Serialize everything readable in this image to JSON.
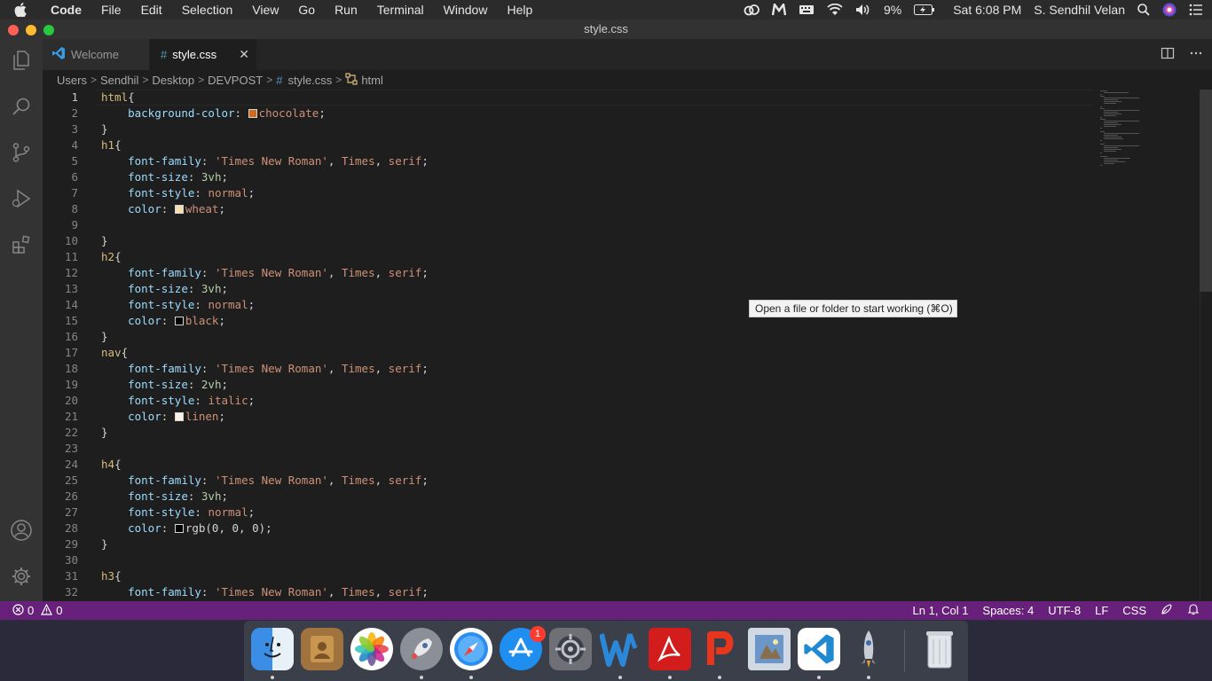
{
  "menubar": {
    "app": "Code",
    "items": [
      "File",
      "Edit",
      "Selection",
      "View",
      "Go",
      "Run",
      "Terminal",
      "Window",
      "Help"
    ],
    "battery": "9%",
    "clock": "Sat 6:08 PM",
    "user": "S. Sendhil Velan"
  },
  "window": {
    "title": "style.css"
  },
  "tabs": [
    {
      "label": "Welcome",
      "icon": "vscode-icon"
    },
    {
      "label": "style.css",
      "icon": "hash-icon",
      "close": "✕"
    }
  ],
  "breadcrumb": [
    "Users",
    "Sendhil",
    "Desktop",
    "DEVPOST",
    "style.css",
    "html"
  ],
  "editor": {
    "current_line": 1,
    "lines": [
      {
        "n": "1"
      },
      {
        "n": "2"
      },
      {
        "n": "3"
      },
      {
        "n": "4"
      },
      {
        "n": "5"
      },
      {
        "n": "6"
      },
      {
        "n": "7"
      },
      {
        "n": "8"
      },
      {
        "n": "9"
      },
      {
        "n": "10"
      },
      {
        "n": "11"
      },
      {
        "n": "12"
      },
      {
        "n": "13"
      },
      {
        "n": "14"
      },
      {
        "n": "15"
      },
      {
        "n": "16"
      },
      {
        "n": "17"
      },
      {
        "n": "18"
      },
      {
        "n": "19"
      },
      {
        "n": "20"
      },
      {
        "n": "21"
      },
      {
        "n": "22"
      },
      {
        "n": "23"
      },
      {
        "n": "24"
      },
      {
        "n": "25"
      },
      {
        "n": "26"
      },
      {
        "n": "27"
      },
      {
        "n": "28"
      },
      {
        "n": "29"
      },
      {
        "n": "30"
      },
      {
        "n": "31"
      },
      {
        "n": "32"
      }
    ],
    "tokens": {
      "html": "html",
      "h1": "h1",
      "h2": "h2",
      "nav": "nav",
      "h4": "h4",
      "h3": "h3",
      "bg": "background-color",
      "chocolate": "chocolate",
      "ff": "font-family",
      "ff_val": "'Times New Roman'",
      "times": "Times",
      "serif": "serif",
      "fs": "font-size",
      "fst": "font-style",
      "color": "color",
      "v3": "3vh",
      "v2": "2vh",
      "normal": "normal",
      "italic": "italic",
      "wheat": "wheat",
      "black": "black",
      "linen": "linen",
      "rgb": "rgb(0, 0, 0)"
    },
    "swatch_colors": {
      "chocolate": "#d2691e",
      "wheat": "#f5deb3",
      "black": "#000000",
      "linen": "#faf0e6"
    }
  },
  "tooltip": "Open a file or folder to start working (⌘O)",
  "status": {
    "errors": "0",
    "warnings": "0",
    "position": "Ln 1, Col 1",
    "spaces": "Spaces: 4",
    "encoding": "UTF-8",
    "eol": "LF",
    "language": "CSS"
  },
  "dock": {
    "apps": [
      "Finder",
      "Contacts",
      "Photos",
      "Launchpad",
      "Safari",
      "App Store",
      "System Preferences",
      "Word",
      "Acrobat",
      "WPS Presentation",
      "Preview",
      "Visual Studio Code",
      "Rocket",
      "Trash"
    ],
    "app_store_badge": "1"
  },
  "colors": {
    "statusbar": "#68217a",
    "editor_bg": "#1e1e1e",
    "activitybar": "#333333"
  }
}
